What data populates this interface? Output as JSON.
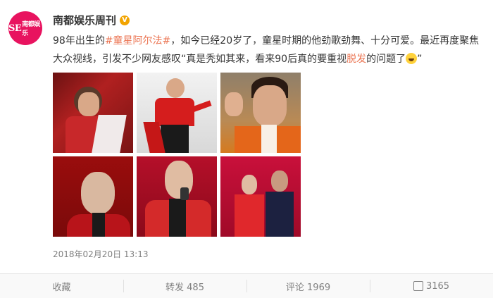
{
  "post": {
    "avatar_text": "南都娱乐",
    "avatar_prefix": "SE",
    "username": "南都娱乐周刊",
    "verified_mark": "V",
    "text_before": "98年出生的",
    "topic": "#童星阿尔法#",
    "text_middle": "，如今已经20岁了，童星时期的他劲歌劲舞、十分可爱。最近再度聚焦大众视线，引发不少网友感叹“真是秃如其来，看来90后真的要重视",
    "link_word": "脱发",
    "text_after": "的问题了",
    "text_end": "”",
    "timestamp": "2018年02月20日 13:13"
  },
  "actions": {
    "favorite": "收藏",
    "repost": "转发 485",
    "comment": "评论 1969",
    "like": "3165"
  },
  "colors": {
    "accent": "#eb7350",
    "avatar_bg": "#e8135f",
    "verified": "#f2a400"
  }
}
